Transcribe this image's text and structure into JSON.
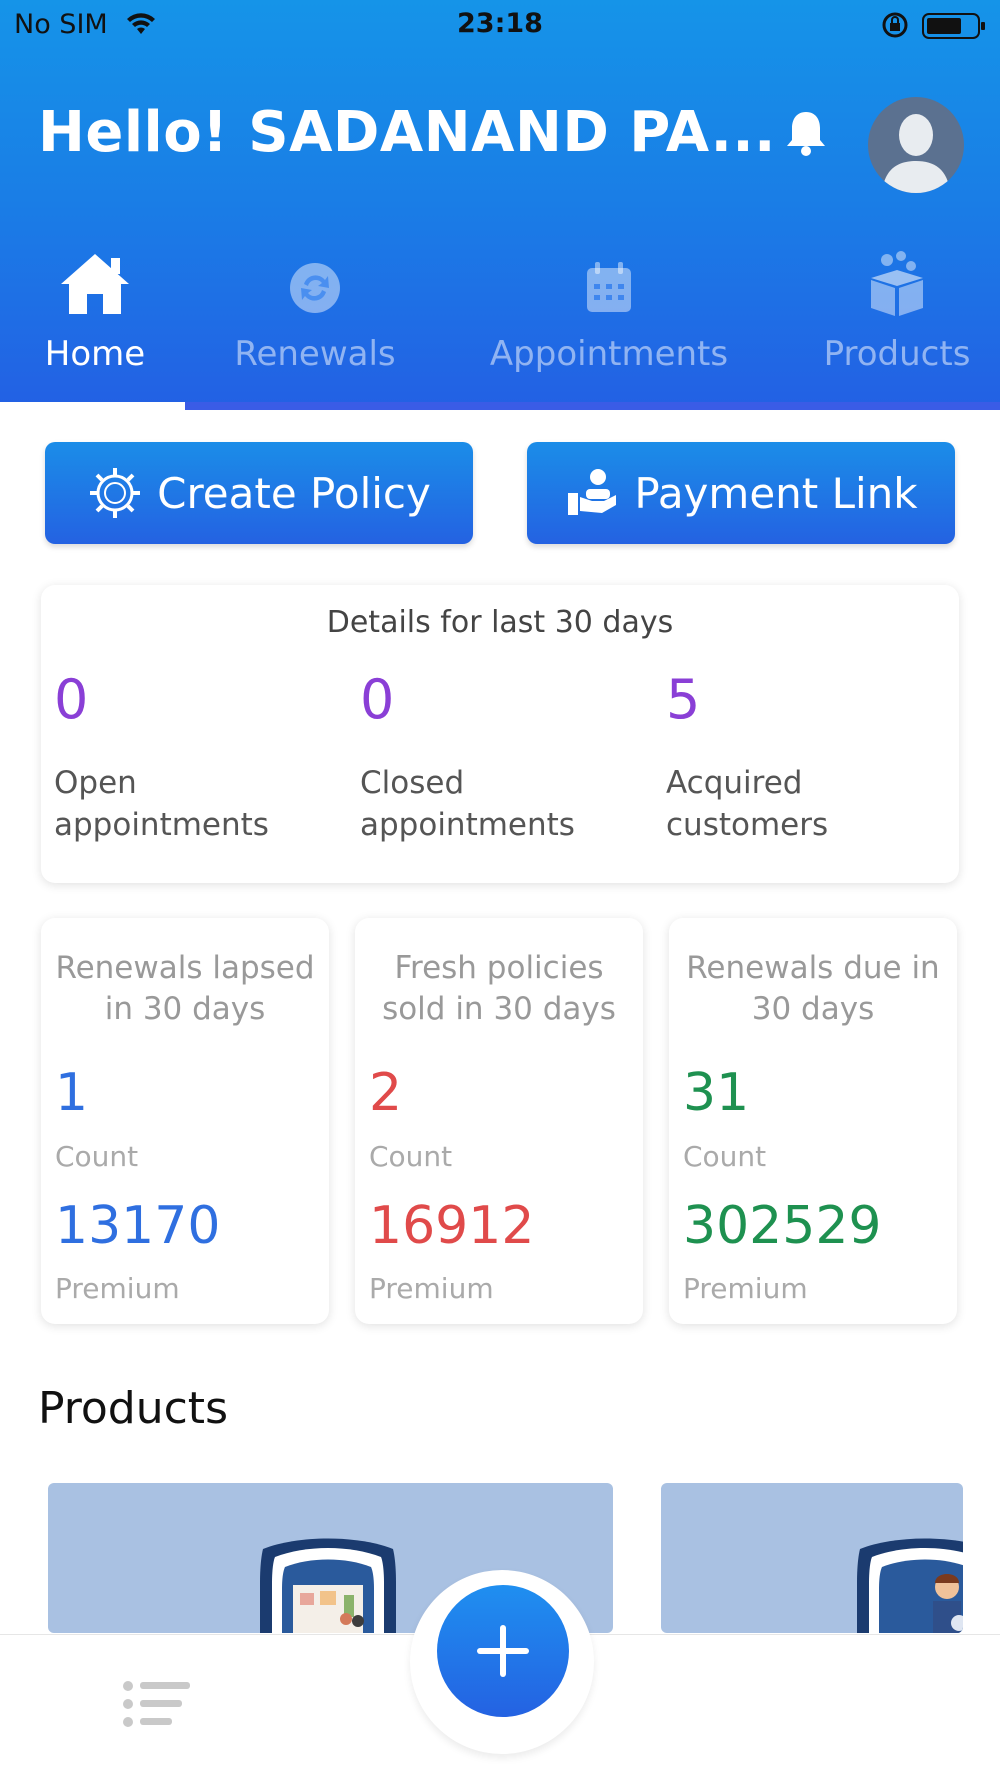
{
  "status_bar": {
    "carrier": "No SIM",
    "time": "23:18"
  },
  "header": {
    "greeting": "Hello! SADANAND PA..."
  },
  "tabs": [
    {
      "label": "Home",
      "icon": "home-icon",
      "active": true
    },
    {
      "label": "Renewals",
      "icon": "refresh-icon",
      "active": false
    },
    {
      "label": "Appointments",
      "icon": "calendar-icon",
      "active": false
    },
    {
      "label": "Products",
      "icon": "gift-box-icon",
      "active": false
    }
  ],
  "actions": {
    "create_policy": "Create Policy",
    "payment_link": "Payment Link"
  },
  "details": {
    "title": "Details for last 30 days",
    "stats": [
      {
        "value": "0",
        "label_line1": "Open",
        "label_line2": "appointments"
      },
      {
        "value": "0",
        "label_line1": "Closed",
        "label_line2": "appointments"
      },
      {
        "value": "5",
        "label_line1": "Acquired",
        "label_line2": "customers"
      }
    ]
  },
  "metrics": [
    {
      "title_line1": "Renewals lapsed",
      "title_line2": "in 30 days",
      "count": "1",
      "count_label": "Count",
      "premium": "13170",
      "premium_label": "Premium",
      "color": "#2f6fe0"
    },
    {
      "title_line1": "Fresh policies",
      "title_line2": "sold in 30 days",
      "count": "2",
      "count_label": "Count",
      "premium": "16912",
      "premium_label": "Premium",
      "color": "#e04a4a"
    },
    {
      "title_line1": "Renewals due in",
      "title_line2": "30 days",
      "count": "31",
      "count_label": "Count",
      "premium": "302529",
      "premium_label": "Premium",
      "color": "#1e9150"
    }
  ],
  "products": {
    "title": "Products"
  },
  "colors": {
    "accent": "#1f7ee8",
    "purple": "#8a3fd6"
  }
}
